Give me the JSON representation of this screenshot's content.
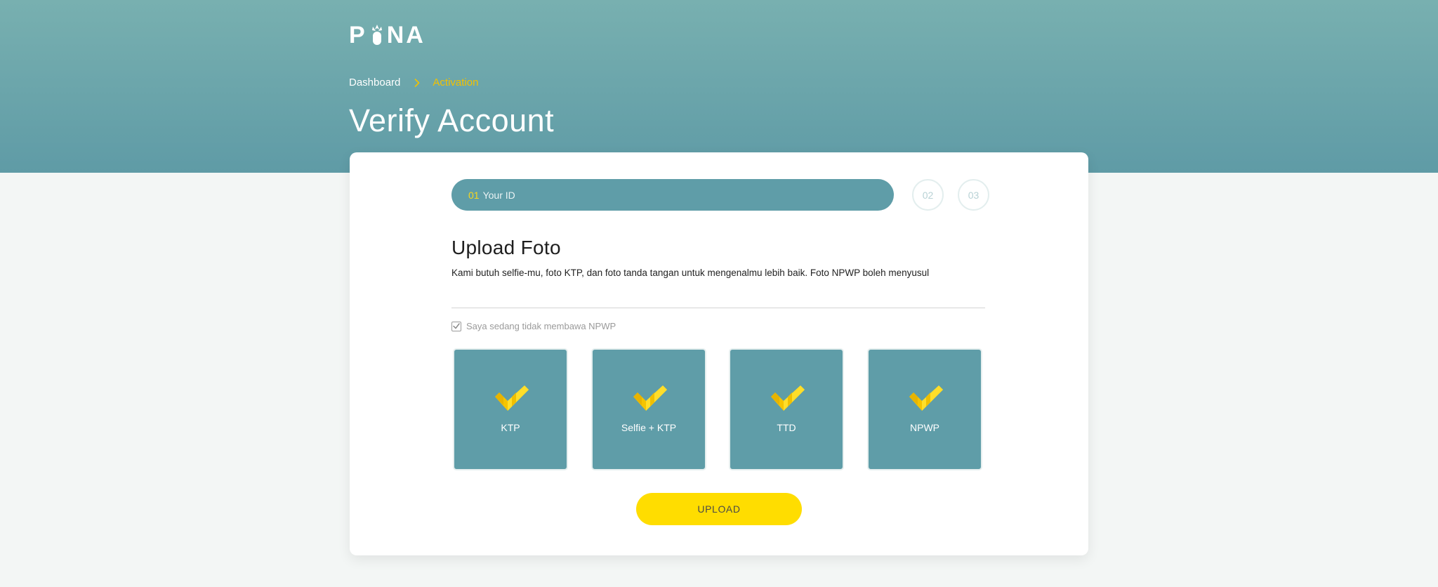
{
  "brand": {
    "logo_text": "PINA",
    "icon": "pineapple-icon"
  },
  "breadcrumb": {
    "home": "Dashboard",
    "separator_icon": "chevron-right-icon",
    "current": "Activation"
  },
  "page": {
    "title": "Verify Account"
  },
  "stepper": {
    "active": {
      "number": "01",
      "label": "Your ID"
    },
    "steps": [
      "02",
      "03"
    ]
  },
  "section": {
    "title": "Upload Foto",
    "description": "Kami butuh selfie-mu, foto KTP, dan foto tanda tangan untuk mengenalmu lebih baik. Foto NPWP boleh menyusul"
  },
  "checkbox": {
    "label": "Saya sedang tidak membawa NPWP",
    "checked": true
  },
  "uploads": [
    {
      "label": "KTP",
      "status": "uploaded",
      "icon": "checkmark-icon"
    },
    {
      "label": "Selfie + KTP",
      "status": "uploaded",
      "icon": "checkmark-icon"
    },
    {
      "label": "TTD",
      "status": "uploaded",
      "icon": "checkmark-icon"
    },
    {
      "label": "NPWP",
      "status": "uploaded",
      "icon": "checkmark-icon"
    }
  ],
  "actions": {
    "upload_label": "UPLOAD"
  },
  "colors": {
    "header_top": "#78b0b0",
    "header_bottom": "#5f9ba6",
    "accent_yellow": "#ffdd00",
    "breadcrumb_active": "#f2c200",
    "tile": "#5f9da8",
    "background": "#f3f6f5"
  }
}
